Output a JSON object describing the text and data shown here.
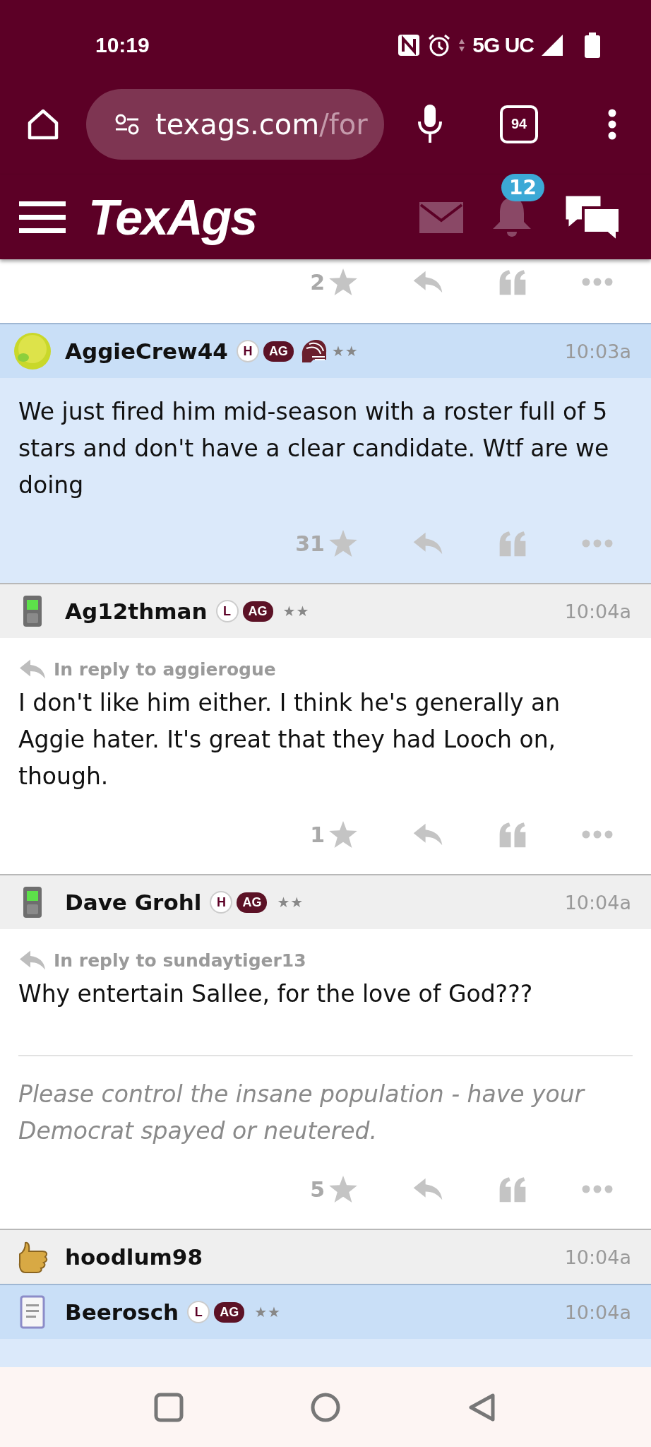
{
  "status_bar": {
    "time": "10:19",
    "network": "5G UC"
  },
  "browser": {
    "url_host": "texags.com",
    "url_path": "/for",
    "tab_count": "94"
  },
  "site_header": {
    "logo": "TexAgs",
    "notification_count": "12"
  },
  "previous_post": {
    "like_count": "2"
  },
  "posts": [
    {
      "username": "AggieCrew44",
      "avatar": {
        "kind": "smiley"
      },
      "badges": [
        {
          "kind": "letter",
          "label": "H"
        },
        {
          "kind": "tag",
          "label": "AG"
        },
        {
          "kind": "helmet"
        }
      ],
      "rank": "★★",
      "time": "10:03a",
      "highlighted": true,
      "body": "We just fired him mid-season with a roster full of 5 stars and don't have a clear candidate. Wtf are we doing",
      "like_count": "31"
    },
    {
      "username": "Ag12thman",
      "avatar": {
        "kind": "phone"
      },
      "badges": [
        {
          "kind": "letter",
          "label": "L"
        },
        {
          "kind": "tag",
          "label": "AG"
        }
      ],
      "rank": "★★",
      "time": "10:04a",
      "highlighted": false,
      "reply_to": "In reply to aggierogue",
      "body": "I don't like him either. I think he's generally an Aggie hater. It's great that they had Looch on, though.",
      "like_count": "1"
    },
    {
      "username": "Dave Grohl",
      "avatar": {
        "kind": "phone"
      },
      "badges": [
        {
          "kind": "letter",
          "label": "H"
        },
        {
          "kind": "tag",
          "label": "AG"
        }
      ],
      "rank": "★★",
      "time": "10:04a",
      "highlighted": false,
      "reply_to": "In reply to sundaytiger13",
      "body": "Why entertain Sallee, for the love of God???",
      "signature": "Please control the insane population - have your Democrat spayed or neutered.",
      "like_count": "5"
    },
    {
      "username": "hoodlum98",
      "avatar": {
        "kind": "thumbs"
      },
      "time": "10:04a",
      "highlighted": false
    },
    {
      "username": "Beerosch",
      "avatar": {
        "kind": "notepad"
      },
      "badges": [
        {
          "kind": "letter",
          "label": "L"
        },
        {
          "kind": "tag",
          "label": "AG"
        }
      ],
      "rank": "★★",
      "time": "10:04a",
      "highlighted": true
    }
  ]
}
